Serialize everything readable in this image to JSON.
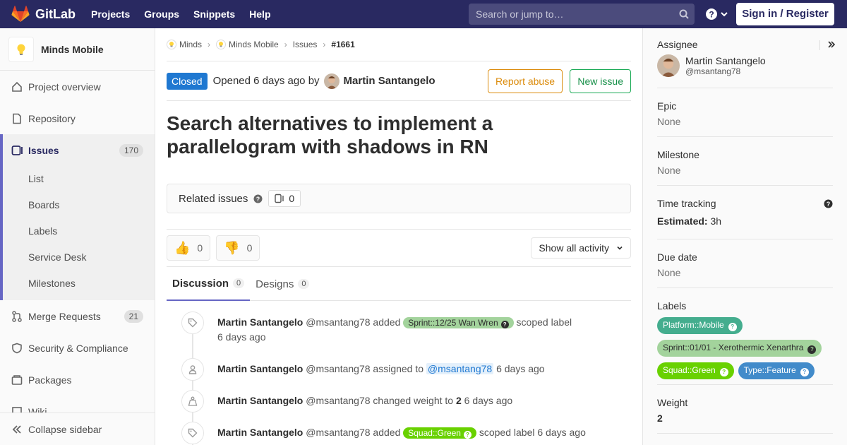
{
  "topbar": {
    "brand": "GitLab",
    "nav": [
      "Projects",
      "Groups",
      "Snippets",
      "Help"
    ],
    "search_placeholder": "Search or jump to…",
    "signin": "Sign in / Register"
  },
  "sidebar": {
    "project_name": "Minds Mobile",
    "items": {
      "overview": "Project overview",
      "repository": "Repository",
      "issues": "Issues",
      "issues_count": "170",
      "merge_requests": "Merge Requests",
      "mr_count": "21",
      "security": "Security & Compliance",
      "packages": "Packages",
      "wiki": "Wiki"
    },
    "sub_items": [
      "List",
      "Boards",
      "Labels",
      "Service Desk",
      "Milestones"
    ],
    "collapse": "Collapse sidebar"
  },
  "breadcrumbs": [
    "Minds",
    "Minds Mobile",
    "Issues",
    "#1661"
  ],
  "issue": {
    "status": "Closed",
    "opened": "Opened 6 days ago by",
    "author": "Martin Santangelo",
    "report_abuse": "Report abuse",
    "new_issue": "New issue",
    "title": "Search alternatives to implement a parallelogram with shadows in RN",
    "related_label": "Related issues",
    "related_count": "0",
    "thumbs_up": "0",
    "thumbs_down": "0",
    "activity_filter": "Show all activity"
  },
  "tabs": [
    {
      "label": "Discussion",
      "count": "0"
    },
    {
      "label": "Designs",
      "count": "0"
    }
  ],
  "timeline": [
    {
      "name": "Martin Santangelo",
      "user": "@msantang78",
      "pre": "added",
      "label": "Sprint::12/25 Wan Wren",
      "post": "scoped label",
      "time": "6 days ago"
    },
    {
      "name": "Martin Santangelo",
      "user": "@msantang78",
      "pre": "assigned to",
      "mention": "@msantang78",
      "time": "6 days ago"
    },
    {
      "name": "Martin Santangelo",
      "user": "@msantang78",
      "pre": "changed weight to",
      "value": "2",
      "time": "6 days ago"
    },
    {
      "name": "Martin Santangelo",
      "user": "@msantang78",
      "pre": "added",
      "label": "Squad::Green",
      "post": "scoped label",
      "time": "6 days ago"
    }
  ],
  "right": {
    "assignee_title": "Assignee",
    "assignee_name": "Martin Santangelo",
    "assignee_user": "@msantang78",
    "epic_title": "Epic",
    "epic_val": "None",
    "milestone_title": "Milestone",
    "milestone_val": "None",
    "time_title": "Time tracking",
    "estimated_label": "Estimated:",
    "estimated_val": "3h",
    "due_title": "Due date",
    "due_val": "None",
    "labels_title": "Labels",
    "labels": [
      {
        "text": "Platform::Mobile",
        "color": "#44ad8e"
      },
      {
        "text": "Sprint::01/01 - Xerothermic Xenarthra",
        "color": "#a3d39c"
      },
      {
        "text": "Squad::Green",
        "color": "#69d100"
      },
      {
        "text": "Type::Feature",
        "color": "#428bca"
      }
    ],
    "weight_title": "Weight",
    "weight_val": "2"
  },
  "colors": {
    "navbar": "#292961",
    "accent": "#6666c4",
    "closed": "#1f78d1"
  }
}
